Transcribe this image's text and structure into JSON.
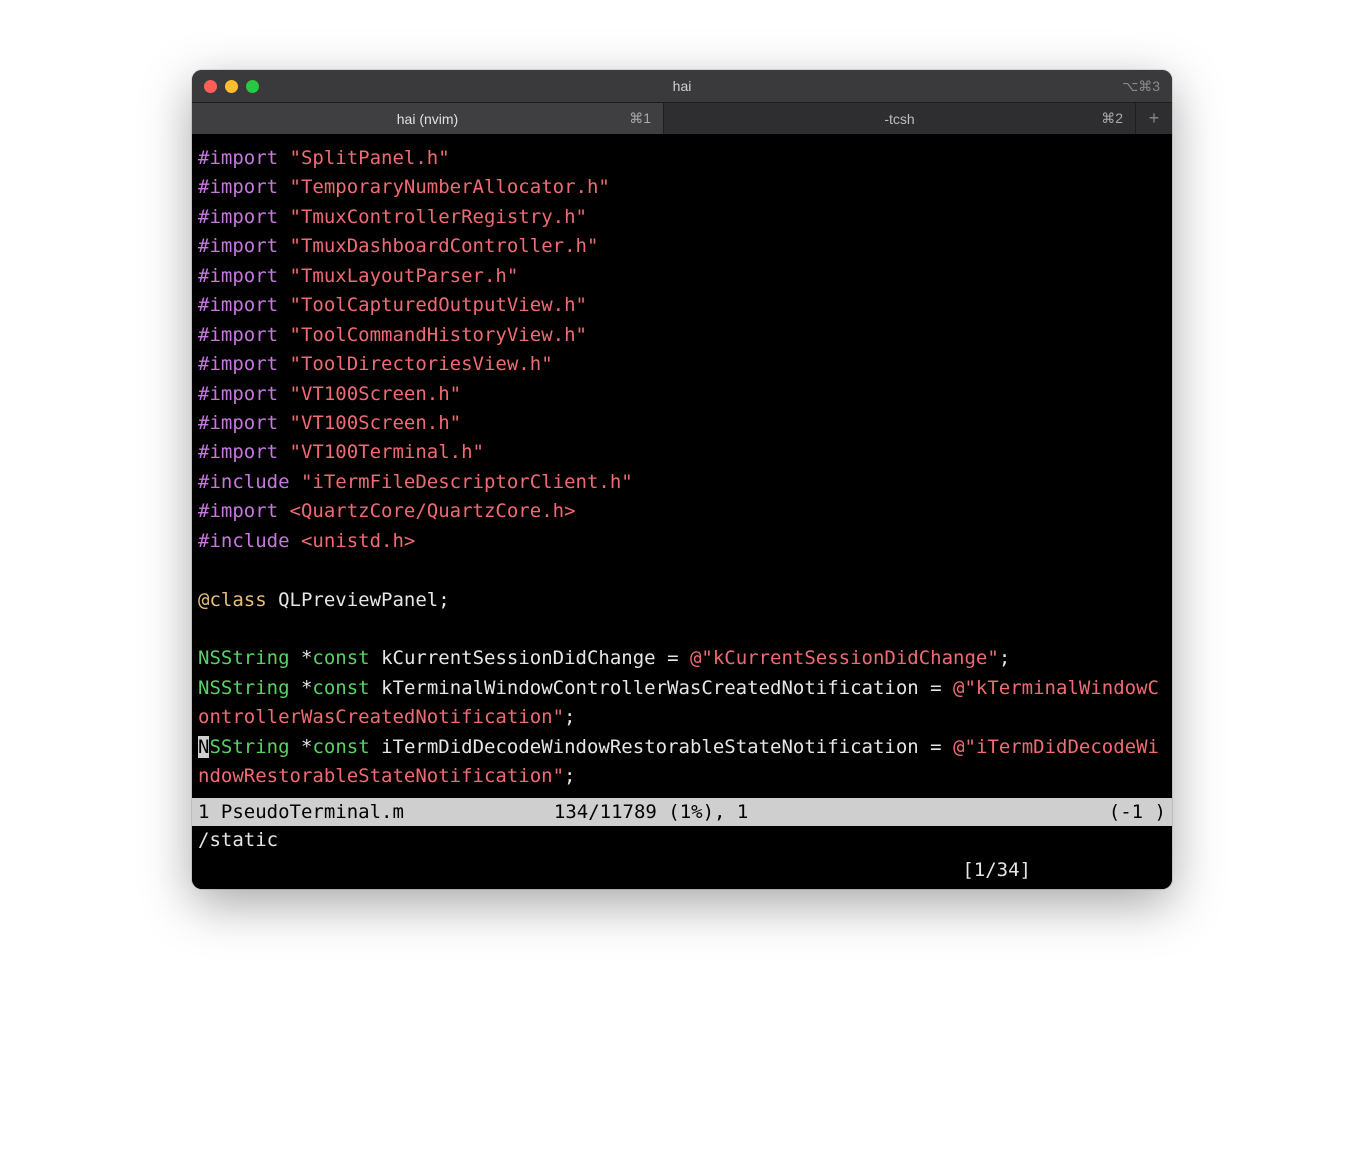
{
  "window": {
    "title": "hai",
    "shortcut_hint": "⌥⌘3"
  },
  "tabs": [
    {
      "label": "hai (nvim)",
      "shortcut": "⌘1",
      "active": true
    },
    {
      "label": "-tcsh",
      "shortcut": "⌘2",
      "active": false
    }
  ],
  "plus": "+",
  "code_lines": [
    {
      "directive": "#import",
      "string": "\"SplitPanel.h\""
    },
    {
      "directive": "#import",
      "string": "\"TemporaryNumberAllocator.h\""
    },
    {
      "directive": "#import",
      "string": "\"TmuxControllerRegistry.h\""
    },
    {
      "directive": "#import",
      "string": "\"TmuxDashboardController.h\""
    },
    {
      "directive": "#import",
      "string": "\"TmuxLayoutParser.h\""
    },
    {
      "directive": "#import",
      "string": "\"ToolCapturedOutputView.h\""
    },
    {
      "directive": "#import",
      "string": "\"ToolCommandHistoryView.h\""
    },
    {
      "directive": "#import",
      "string": "\"ToolDirectoriesView.h\""
    },
    {
      "directive": "#import",
      "string": "\"VT100Screen.h\""
    },
    {
      "directive": "#import",
      "string": "\"VT100Screen.h\""
    },
    {
      "directive": "#import",
      "string": "\"VT100Terminal.h\""
    },
    {
      "directive": "#include",
      "string": "\"iTermFileDescriptorClient.h\""
    },
    {
      "directive": "#import",
      "string": "<QuartzCore/QuartzCore.h>"
    },
    {
      "directive": "#include",
      "string": "<unistd.h>"
    }
  ],
  "class_decl": {
    "keyword": "@class",
    "name": "QLPreviewPanel;"
  },
  "consts": [
    {
      "type": "NSString",
      "star_const": "*const",
      "name": "kCurrentSessionDidChange",
      "value": "@\"kCurrentSessionDidChange\""
    },
    {
      "type": "NSString",
      "star_const": "*const",
      "name": "kTerminalWindowControllerWasCreatedNotification",
      "value": "@\"kTerminalWindowControllerWasCreatedNotification\""
    },
    {
      "type": "NSString",
      "star_const": "*const",
      "name": "iTermDidDecodeWindowRestorableStateNotification",
      "value": "@\"iTermDidDecodeWindowRestorableStateNotification\"",
      "cursor_at_start": true
    }
  ],
  "statusbar": {
    "left": "1 PseudoTerminal.m",
    "center": "134/11789 (1%), 1",
    "right": "(-1 )"
  },
  "cmdline": {
    "search": "/static",
    "count": "[1/34]"
  }
}
